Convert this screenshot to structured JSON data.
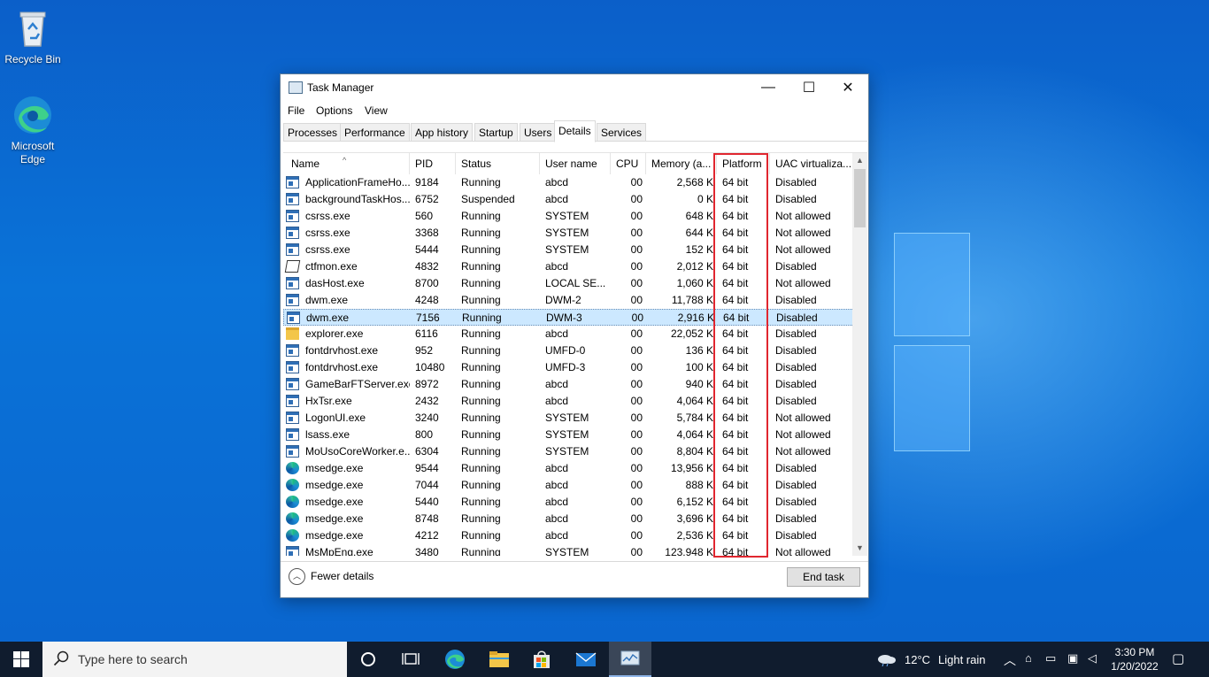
{
  "desktop": {
    "icons": [
      {
        "label": "Recycle Bin"
      },
      {
        "label": "Microsoft Edge"
      }
    ]
  },
  "window": {
    "title": "Task Manager",
    "controls": {
      "minimize": "—",
      "maximize": "☐",
      "close": "✕"
    },
    "menu": [
      "File",
      "Options",
      "View"
    ],
    "tabs": [
      "Processes",
      "Performance",
      "App history",
      "Startup",
      "Users",
      "Details",
      "Services"
    ],
    "active_tab": "Details",
    "columns": [
      "Name",
      "PID",
      "Status",
      "User name",
      "CPU",
      "Memory (a...",
      "Platform",
      "UAC virtualiza..."
    ],
    "rows": [
      {
        "name": "ApplicationFrameHo...",
        "pid": "9184",
        "status": "Running",
        "user": "abcd",
        "cpu": "00",
        "memory": "2,568 K",
        "platform": "64 bit",
        "uac": "Disabled",
        "icon": "exe"
      },
      {
        "name": "backgroundTaskHos...",
        "pid": "6752",
        "status": "Suspended",
        "user": "abcd",
        "cpu": "00",
        "memory": "0 K",
        "platform": "64 bit",
        "uac": "Disabled",
        "icon": "exe"
      },
      {
        "name": "csrss.exe",
        "pid": "560",
        "status": "Running",
        "user": "SYSTEM",
        "cpu": "00",
        "memory": "648 K",
        "platform": "64 bit",
        "uac": "Not allowed",
        "icon": "exe"
      },
      {
        "name": "csrss.exe",
        "pid": "3368",
        "status": "Running",
        "user": "SYSTEM",
        "cpu": "00",
        "memory": "644 K",
        "platform": "64 bit",
        "uac": "Not allowed",
        "icon": "exe"
      },
      {
        "name": "csrss.exe",
        "pid": "5444",
        "status": "Running",
        "user": "SYSTEM",
        "cpu": "00",
        "memory": "152 K",
        "platform": "64 bit",
        "uac": "Not allowed",
        "icon": "exe"
      },
      {
        "name": "ctfmon.exe",
        "pid": "4832",
        "status": "Running",
        "user": "abcd",
        "cpu": "00",
        "memory": "2,012 K",
        "platform": "64 bit",
        "uac": "Disabled",
        "icon": "pen"
      },
      {
        "name": "dasHost.exe",
        "pid": "8700",
        "status": "Running",
        "user": "LOCAL SE...",
        "cpu": "00",
        "memory": "1,060 K",
        "platform": "64 bit",
        "uac": "Not allowed",
        "icon": "exe"
      },
      {
        "name": "dwm.exe",
        "pid": "4248",
        "status": "Running",
        "user": "DWM-2",
        "cpu": "00",
        "memory": "11,788 K",
        "platform": "64 bit",
        "uac": "Disabled",
        "icon": "exe"
      },
      {
        "name": "dwm.exe",
        "pid": "7156",
        "status": "Running",
        "user": "DWM-3",
        "cpu": "00",
        "memory": "2,916 K",
        "platform": "64 bit",
        "uac": "Disabled",
        "icon": "exe",
        "selected": true
      },
      {
        "name": "explorer.exe",
        "pid": "6116",
        "status": "Running",
        "user": "abcd",
        "cpu": "00",
        "memory": "22,052 K",
        "platform": "64 bit",
        "uac": "Disabled",
        "icon": "folder"
      },
      {
        "name": "fontdrvhost.exe",
        "pid": "952",
        "status": "Running",
        "user": "UMFD-0",
        "cpu": "00",
        "memory": "136 K",
        "platform": "64 bit",
        "uac": "Disabled",
        "icon": "exe"
      },
      {
        "name": "fontdrvhost.exe",
        "pid": "10480",
        "status": "Running",
        "user": "UMFD-3",
        "cpu": "00",
        "memory": "100 K",
        "platform": "64 bit",
        "uac": "Disabled",
        "icon": "exe"
      },
      {
        "name": "GameBarFTServer.exe",
        "pid": "8972",
        "status": "Running",
        "user": "abcd",
        "cpu": "00",
        "memory": "940 K",
        "platform": "64 bit",
        "uac": "Disabled",
        "icon": "exe"
      },
      {
        "name": "HxTsr.exe",
        "pid": "2432",
        "status": "Running",
        "user": "abcd",
        "cpu": "00",
        "memory": "4,064 K",
        "platform": "64 bit",
        "uac": "Disabled",
        "icon": "exe"
      },
      {
        "name": "LogonUI.exe",
        "pid": "3240",
        "status": "Running",
        "user": "SYSTEM",
        "cpu": "00",
        "memory": "5,784 K",
        "platform": "64 bit",
        "uac": "Not allowed",
        "icon": "exe"
      },
      {
        "name": "lsass.exe",
        "pid": "800",
        "status": "Running",
        "user": "SYSTEM",
        "cpu": "00",
        "memory": "4,064 K",
        "platform": "64 bit",
        "uac": "Not allowed",
        "icon": "exe"
      },
      {
        "name": "MoUsoCoreWorker.e...",
        "pid": "6304",
        "status": "Running",
        "user": "SYSTEM",
        "cpu": "00",
        "memory": "8,804 K",
        "platform": "64 bit",
        "uac": "Not allowed",
        "icon": "exe"
      },
      {
        "name": "msedge.exe",
        "pid": "9544",
        "status": "Running",
        "user": "abcd",
        "cpu": "00",
        "memory": "13,956 K",
        "platform": "64 bit",
        "uac": "Disabled",
        "icon": "edge"
      },
      {
        "name": "msedge.exe",
        "pid": "7044",
        "status": "Running",
        "user": "abcd",
        "cpu": "00",
        "memory": "888 K",
        "platform": "64 bit",
        "uac": "Disabled",
        "icon": "edge"
      },
      {
        "name": "msedge.exe",
        "pid": "5440",
        "status": "Running",
        "user": "abcd",
        "cpu": "00",
        "memory": "6,152 K",
        "platform": "64 bit",
        "uac": "Disabled",
        "icon": "edge"
      },
      {
        "name": "msedge.exe",
        "pid": "8748",
        "status": "Running",
        "user": "abcd",
        "cpu": "00",
        "memory": "3,696 K",
        "platform": "64 bit",
        "uac": "Disabled",
        "icon": "edge"
      },
      {
        "name": "msedge.exe",
        "pid": "4212",
        "status": "Running",
        "user": "abcd",
        "cpu": "00",
        "memory": "2,536 K",
        "platform": "64 bit",
        "uac": "Disabled",
        "icon": "edge"
      },
      {
        "name": "MsMpEng.exe",
        "pid": "3480",
        "status": "Running",
        "user": "SYSTEM",
        "cpu": "00",
        "memory": "123,948 K",
        "platform": "64 bit",
        "uac": "Not allowed",
        "icon": "exe"
      }
    ],
    "footer": {
      "fewer_details": "Fewer details",
      "end_task": "End task"
    },
    "highlight_color": "#e0262f"
  },
  "taskbar": {
    "search_placeholder": "Type here to search",
    "weather": {
      "temp": "12°C",
      "condition": "Light rain"
    },
    "clock": {
      "time": "3:30 PM",
      "date": "1/20/2022"
    }
  }
}
